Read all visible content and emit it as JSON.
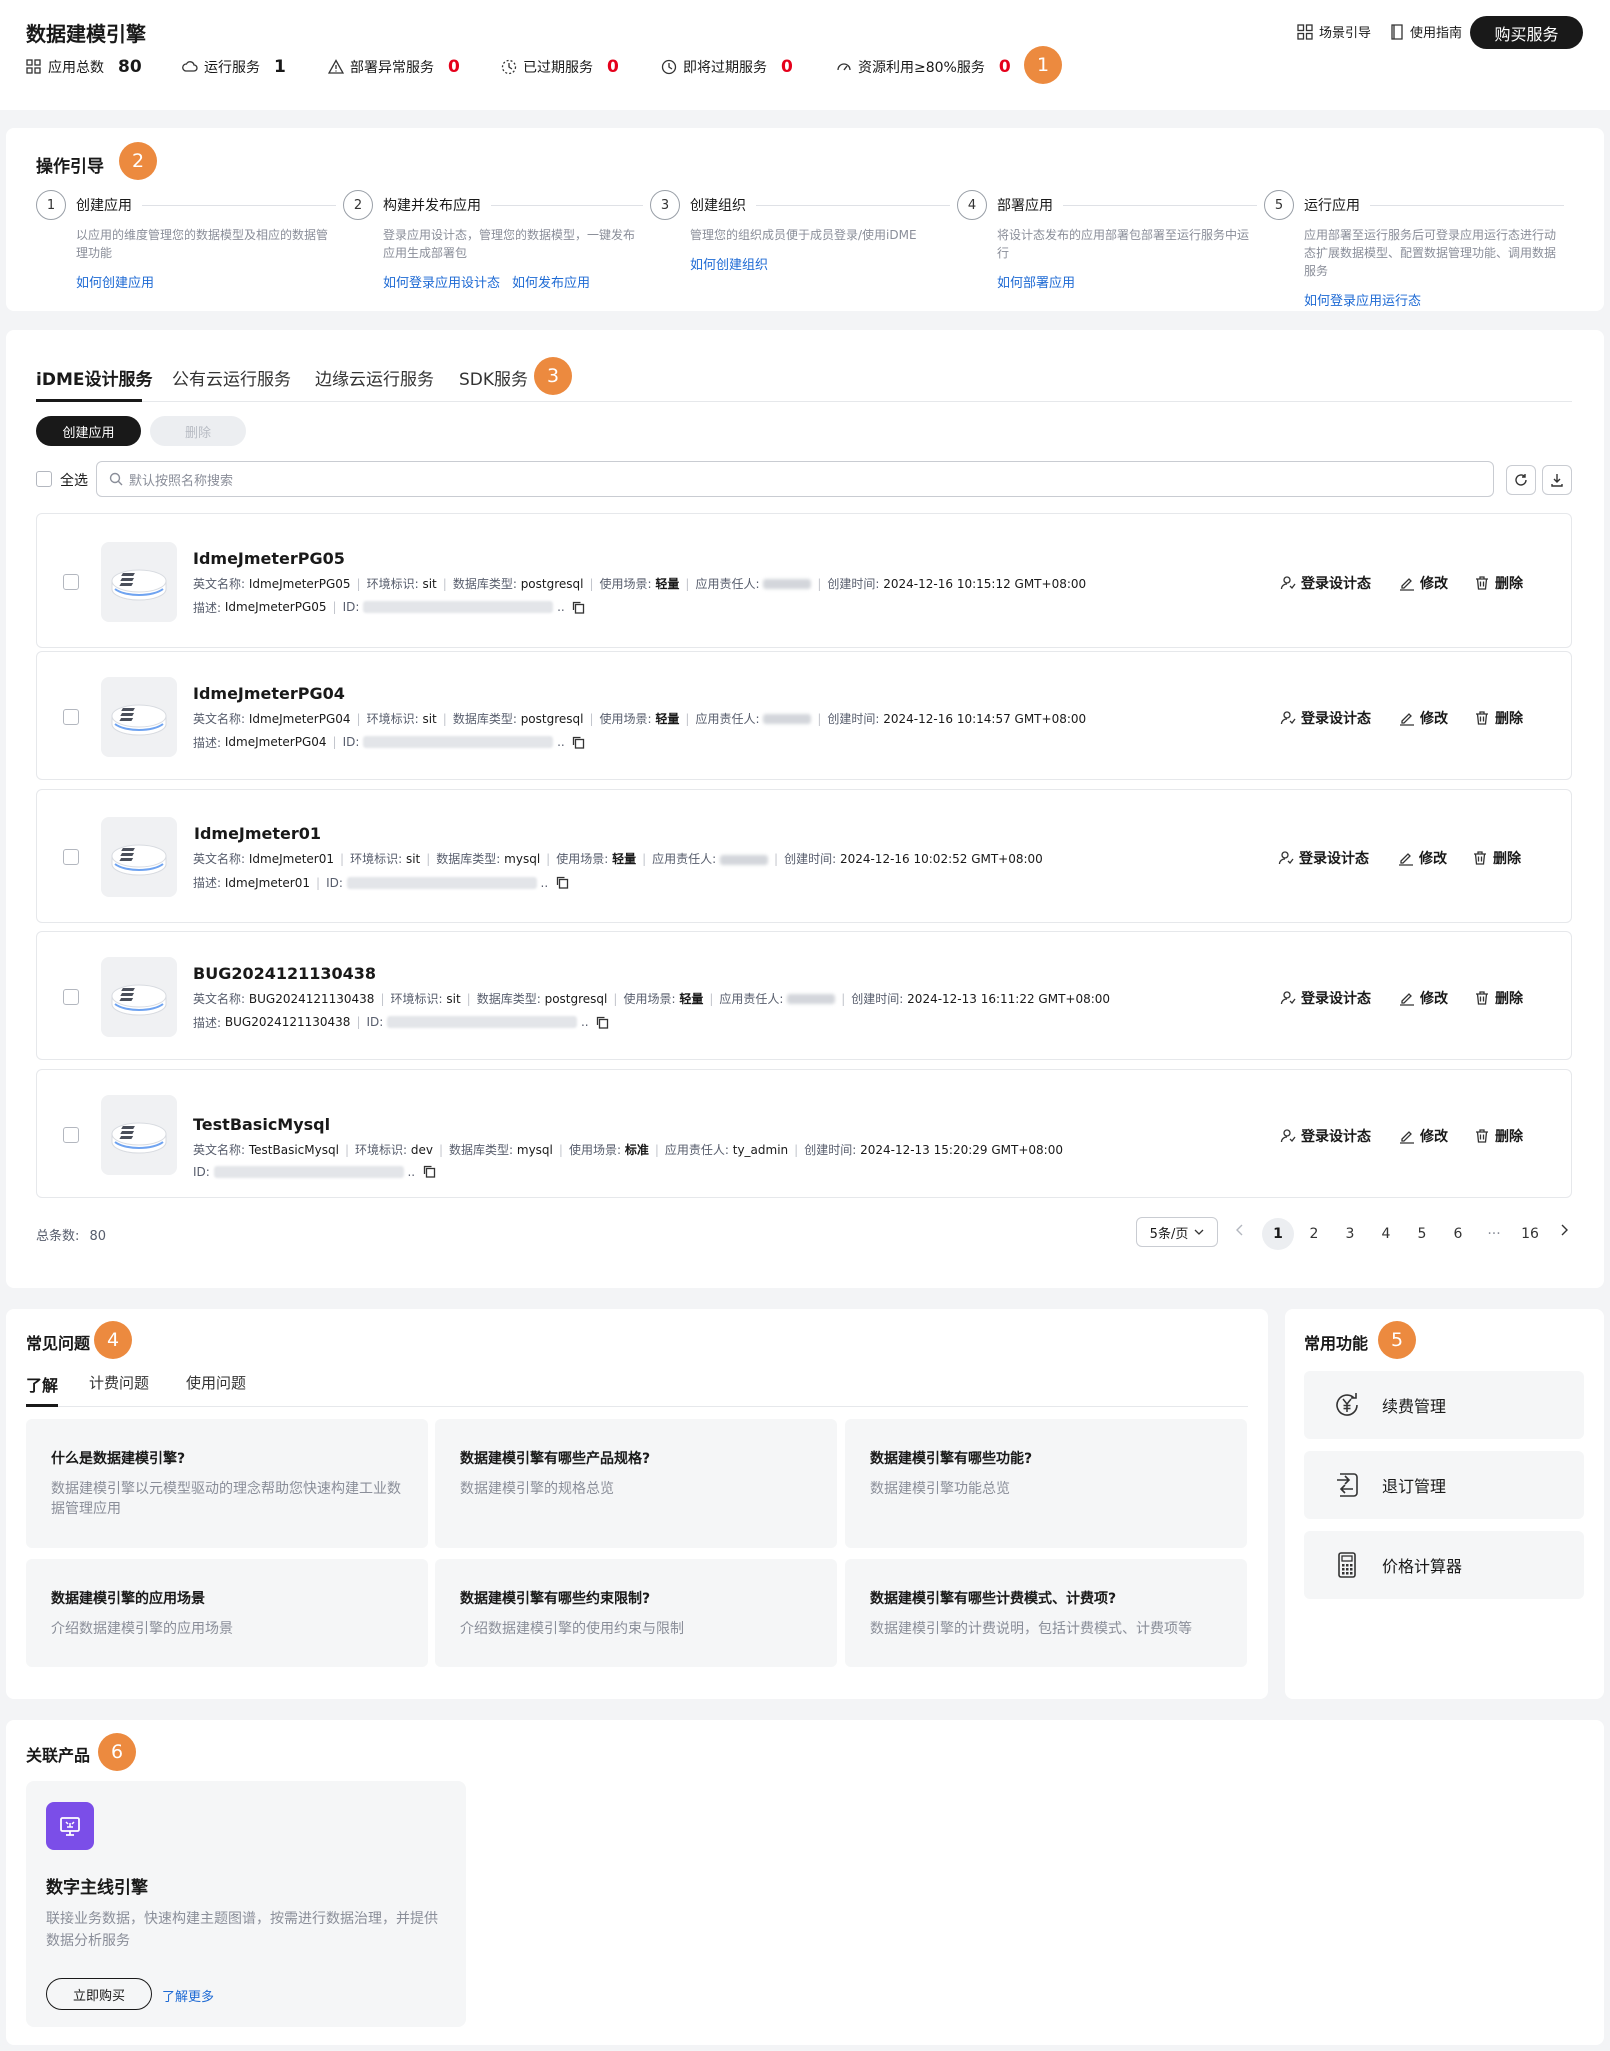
{
  "header": {
    "title": "数据建模引擎",
    "scene_guide": "场景引导",
    "usage_guide": "使用指南",
    "buy_button": "购买服务",
    "stats": [
      {
        "label": "应用总数",
        "value": "80",
        "red": false
      },
      {
        "label": "运行服务",
        "value": "1",
        "red": false
      },
      {
        "label": "部署异常服务",
        "value": "0",
        "red": true
      },
      {
        "label": "已过期服务",
        "value": "0",
        "red": true
      },
      {
        "label": "即将过期服务",
        "value": "0",
        "red": true
      },
      {
        "label": "资源利用≥80%服务",
        "value": "0",
        "red": true
      }
    ],
    "marker": "1"
  },
  "guide": {
    "title": "操作引导",
    "marker": "2",
    "steps": [
      {
        "num": "1",
        "title": "创建应用",
        "desc": "以应用的维度管理您的数据模型及相应的数据管理功能",
        "links": [
          "如何创建应用"
        ]
      },
      {
        "num": "2",
        "title": "构建并发布应用",
        "desc": "登录应用设计态，管理您的数据模型，一键发布应用生成部署包",
        "links": [
          "如何登录应用设计态",
          "如何发布应用"
        ]
      },
      {
        "num": "3",
        "title": "创建组织",
        "desc": "管理您的组织成员便于成员登录/使用iDME",
        "links": [
          "如何创建组织"
        ]
      },
      {
        "num": "4",
        "title": "部署应用",
        "desc": "将设计态发布的应用部署包部署至运行服务中运行",
        "links": [
          "如何部署应用"
        ]
      },
      {
        "num": "5",
        "title": "运行应用",
        "desc": "应用部署至运行服务后可登录应用运行态进行动态扩展数据模型、配置数据管理功能、调用数据服务",
        "links": [
          "如何登录应用运行态"
        ]
      }
    ]
  },
  "services": {
    "marker": "3",
    "tabs": [
      "iDME设计服务",
      "公有云运行服务",
      "边缘云运行服务",
      "SDK服务"
    ],
    "active_tab": 0,
    "create_button": "创建应用",
    "delete_button": "删除",
    "select_all": "全选",
    "search_placeholder": "默认按照名称搜索",
    "field_labels": {
      "en_name": "英文名称:",
      "env": "环境标识:",
      "db_type": "数据库类型:",
      "scene": "使用场景:",
      "owner": "应用责任人:",
      "created": "创建时间:",
      "desc": "描述:",
      "id": "ID:"
    },
    "action_labels": {
      "login": "登录设计态",
      "edit": "修改",
      "delete": "删除"
    },
    "apps": [
      {
        "name": "IdmeJmeterPG05",
        "en_name": "IdmeJmeterPG05",
        "env": "sit",
        "db_type": "postgresql",
        "scene": "轻量",
        "owner": "",
        "created": "2024-12-16 10:15:12 GMT+08:00",
        "desc": "IdmeJmeterPG05"
      },
      {
        "name": "IdmeJmeterPG04",
        "en_name": "IdmeJmeterPG04",
        "env": "sit",
        "db_type": "postgresql",
        "scene": "轻量",
        "owner": "",
        "created": "2024-12-16 10:14:57 GMT+08:00",
        "desc": "IdmeJmeterPG04"
      },
      {
        "name": "IdmeJmeter01",
        "en_name": "IdmeJmeter01",
        "env": "sit",
        "db_type": "mysql",
        "scene": "轻量",
        "owner": "",
        "created": "2024-12-16 10:02:52 GMT+08:00",
        "desc": "IdmeJmeter01"
      },
      {
        "name": "BUG2024121130438",
        "en_name": "BUG2024121130438",
        "env": "sit",
        "db_type": "postgresql",
        "scene": "轻量",
        "owner": "",
        "created": "2024-12-13 16:11:22 GMT+08:00",
        "desc": "BUG2024121130438"
      },
      {
        "name": "TestBasicMysql",
        "en_name": "TestBasicMysql",
        "env": "dev",
        "db_type": "mysql",
        "scene": "标准",
        "owner": "ty_admin",
        "created": "2024-12-13 15:20:29 GMT+08:00",
        "desc": ""
      }
    ],
    "total_label": "总条数:",
    "total": "80",
    "page_size": "5条/页",
    "pages": [
      "1",
      "2",
      "3",
      "4",
      "5",
      "6",
      "···",
      "16"
    ],
    "current_page": "1"
  },
  "faq": {
    "title": "常见问题",
    "marker": "4",
    "tabs": [
      "了解",
      "计费问题",
      "使用问题"
    ],
    "items": [
      {
        "q": "什么是数据建模引擎?",
        "a": "数据建模引擎以元模型驱动的理念帮助您快速构建工业数据管理应用"
      },
      {
        "q": "数据建模引擎有哪些产品规格?",
        "a": "数据建模引擎的规格总览"
      },
      {
        "q": "数据建模引擎有哪些功能?",
        "a": "数据建模引擎功能总览"
      },
      {
        "q": "数据建模引擎的应用场景",
        "a": "介绍数据建模引擎的应用场景"
      },
      {
        "q": "数据建模引擎有哪些约束限制?",
        "a": "介绍数据建模引擎的使用约束与限制"
      },
      {
        "q": "数据建模引擎有哪些计费模式、计费项?",
        "a": "数据建模引擎的计费说明，包括计费模式、计费项等"
      }
    ]
  },
  "common": {
    "title": "常用功能",
    "marker": "5",
    "items": [
      "续费管理",
      "退订管理",
      "价格计算器"
    ]
  },
  "related": {
    "title": "关联产品",
    "marker": "6",
    "product_name": "数字主线引擎",
    "product_desc": "联接业务数据，快速构建主题图谱，按需进行数据治理，并提供数据分析服务",
    "buy_now": "立即购买",
    "learn_more": "了解更多"
  }
}
